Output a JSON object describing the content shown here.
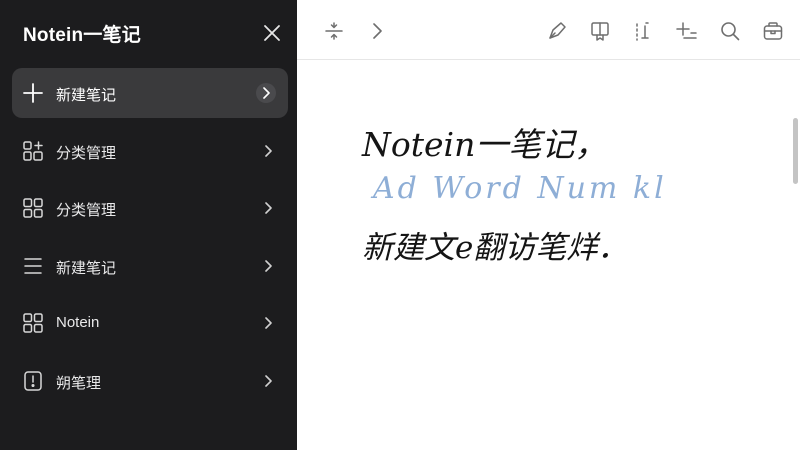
{
  "sidebar": {
    "title": "Notein一笔记",
    "items": [
      {
        "label": "新建笔记",
        "icon": "plus-icon"
      },
      {
        "label": "分类管理",
        "icon": "category-grid-icon"
      },
      {
        "label": "分类管理",
        "icon": "grid-icon"
      },
      {
        "label": "新建笔记",
        "icon": "list-icon"
      },
      {
        "label": "Notein",
        "icon": "grid-icon"
      },
      {
        "label": "朔笔理",
        "icon": "info-card-icon"
      }
    ]
  },
  "toolbar": {
    "icons": [
      "split-icon",
      "chevron-right-icon",
      "pen-icon",
      "bookmark-icon",
      "text-insert-icon",
      "add-page-icon",
      "search-icon",
      "toolbox-icon"
    ]
  },
  "note": {
    "line1": "Notein一笔记，",
    "line2": "Ad Word Num kl",
    "line3": "新建文e翻访笔烊．"
  },
  "colors": {
    "sidebar_bg": "#1c1c1e",
    "active_item_bg": "#3a3a3c",
    "ink": "#151515",
    "blue_ink": "#8eaed6"
  }
}
